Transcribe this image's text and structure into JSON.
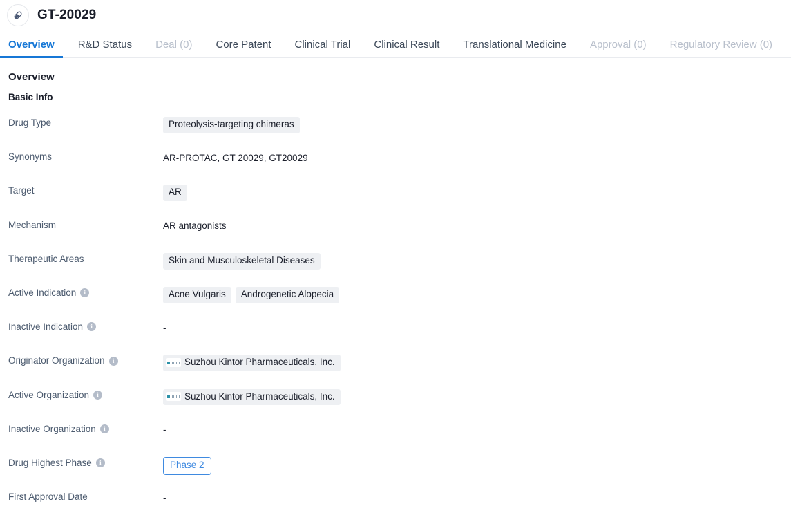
{
  "header": {
    "icon": "pill-capsule-icon",
    "title": "GT-20029"
  },
  "tabs": [
    {
      "label": "Overview",
      "state": "active"
    },
    {
      "label": "R&D Status",
      "state": "normal"
    },
    {
      "label": "Deal (0)",
      "state": "disabled"
    },
    {
      "label": "Core Patent",
      "state": "normal"
    },
    {
      "label": "Clinical Trial",
      "state": "normal"
    },
    {
      "label": "Clinical Result",
      "state": "normal"
    },
    {
      "label": "Translational Medicine",
      "state": "normal"
    },
    {
      "label": "Approval (0)",
      "state": "disabled"
    },
    {
      "label": "Regulatory Review (0)",
      "state": "disabled"
    }
  ],
  "content": {
    "section_title": "Overview",
    "subsection_title": "Basic Info",
    "rows": [
      {
        "label": "Drug Type",
        "has_info": false,
        "type": "tags",
        "values": [
          "Proteolysis-targeting chimeras"
        ]
      },
      {
        "label": "Synonyms",
        "has_info": false,
        "type": "plain",
        "value": "AR-PROTAC,  GT 20029,  GT20029"
      },
      {
        "label": "Target",
        "has_info": false,
        "type": "tags",
        "values": [
          "AR"
        ]
      },
      {
        "label": "Mechanism",
        "has_info": false,
        "type": "plain",
        "value": "AR antagonists"
      },
      {
        "label": "Therapeutic Areas",
        "has_info": false,
        "type": "tags",
        "values": [
          "Skin and Musculoskeletal Diseases"
        ]
      },
      {
        "label": "Active Indication",
        "has_info": true,
        "type": "tags",
        "values": [
          "Acne Vulgaris",
          "Androgenetic Alopecia"
        ]
      },
      {
        "label": "Inactive Indication",
        "has_info": true,
        "type": "dash",
        "value": "-"
      },
      {
        "label": "Originator Organization",
        "has_info": true,
        "type": "org",
        "values": [
          "Suzhou Kintor Pharmaceuticals, Inc."
        ]
      },
      {
        "label": "Active Organization",
        "has_info": true,
        "type": "org",
        "values": [
          "Suzhou Kintor Pharmaceuticals, Inc."
        ]
      },
      {
        "label": "Inactive Organization",
        "has_info": true,
        "type": "dash",
        "value": "-"
      },
      {
        "label": "Drug Highest Phase",
        "has_info": true,
        "type": "phase",
        "value": "Phase 2"
      },
      {
        "label": "First Approval Date",
        "has_info": false,
        "type": "dash",
        "value": "-"
      }
    ]
  },
  "colors": {
    "accent": "#1677d6",
    "tag_bg": "#eef0f3",
    "label_text": "#4b5a6e",
    "value_text": "#1b1f2b",
    "disabled_tab": "#b9c0cc",
    "phase_blue": "#3f8ae0"
  }
}
